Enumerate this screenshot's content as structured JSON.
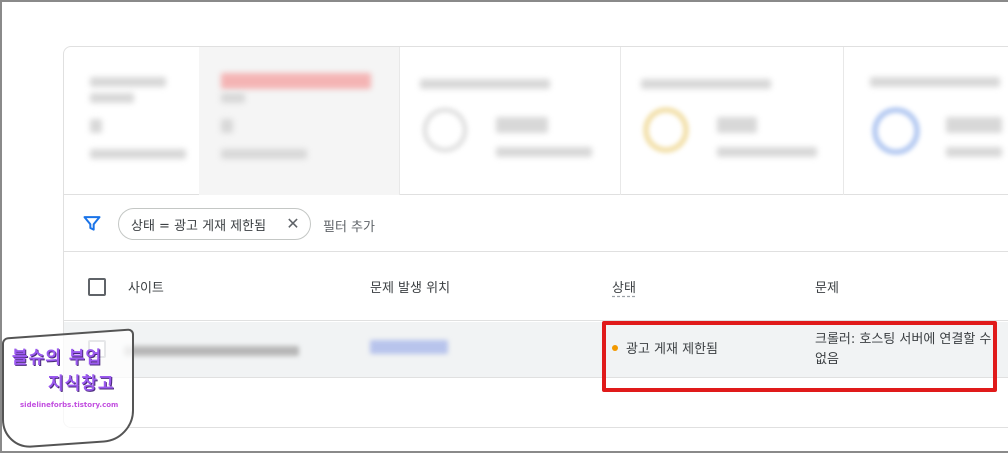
{
  "filter": {
    "chip_label": "상태 = 광고 게재 제한됨",
    "add_filter_label": "필터 추가",
    "filter_icon": "funnel-icon",
    "close_icon": "close-icon"
  },
  "table": {
    "columns": [
      "사이트",
      "문제 발생 위치",
      "상태",
      "문제"
    ],
    "rows": [
      {
        "status": "광고 게재 제한됨",
        "issue": "크롤러: 호스팅 서버에 연결할 수 없음"
      }
    ]
  },
  "watermark": {
    "line1": "블슈의 부업",
    "line2": "지식창고",
    "url": "sidelineforbs.tistory.com"
  },
  "colors": {
    "status_dot": "#f29900",
    "highlight": "#e01a1a",
    "filter_icon": "#1a73e8"
  }
}
